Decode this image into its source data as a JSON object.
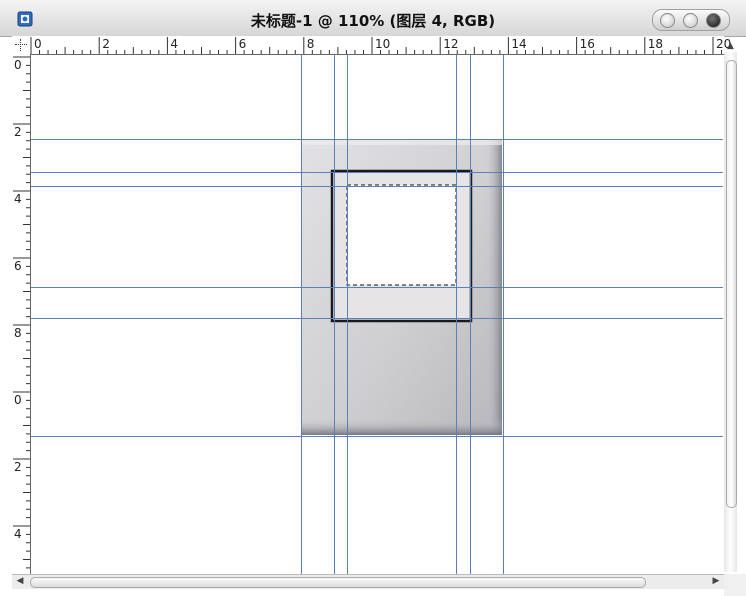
{
  "window": {
    "title": "未标题-1 @ 110% (图层 4, RGB)"
  },
  "icons": {
    "app": "photoshop-document-icon",
    "close": "close-icon",
    "minimize": "minimize-icon",
    "zoom": "zoom-icon"
  },
  "rulers": {
    "horizontal_labels": [
      "0",
      "2",
      "4",
      "6",
      "8",
      "10",
      "12",
      "14",
      "16",
      "18",
      "20"
    ],
    "vertical_labels": [
      "0",
      "2",
      "4",
      "6",
      "8",
      "0",
      "2",
      "4"
    ]
  },
  "colors": {
    "guide": "#5b7fb8",
    "background": "#ffffff",
    "frame_dark": "#1a1a1a"
  }
}
